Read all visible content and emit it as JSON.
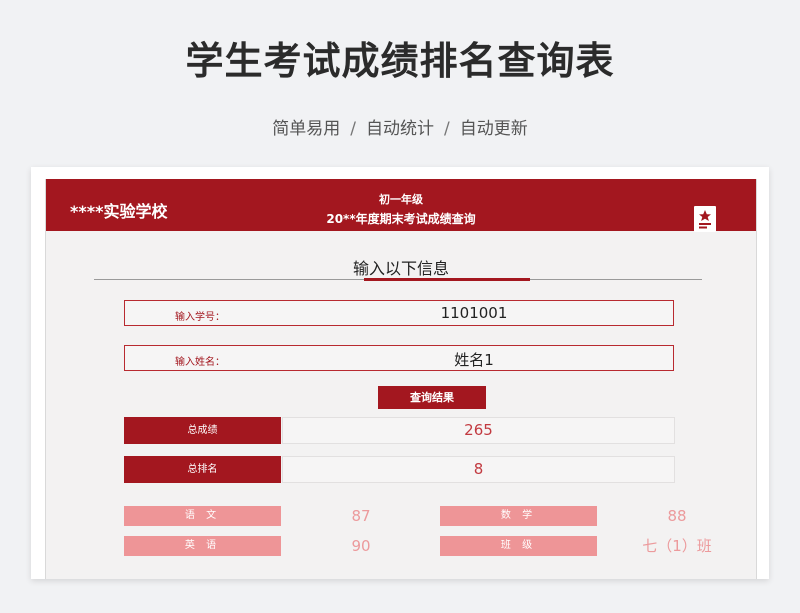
{
  "header": {
    "title": "学生考试成绩排名查询表",
    "subtitle_items": [
      "简单易用",
      "自动统计",
      "自动更新"
    ],
    "separator": "/"
  },
  "sheet": {
    "school": "****实验学校",
    "grade": "初一年级",
    "term": "20**年度期末考试成绩查询",
    "section_title": "输入以下信息",
    "inputs": {
      "student_id_label": "输入学号：",
      "student_id_value": "1101001",
      "name_label": "输入姓名：",
      "name_value": "姓名1"
    },
    "query_button": "查询结果",
    "results": {
      "total_label": "总成绩",
      "total_value": "265",
      "rank_label": "总排名",
      "rank_value": "8"
    },
    "details": {
      "chinese_label": "语 文",
      "chinese_value": "87",
      "math_label": "数 学",
      "math_value": "88",
      "english_label": "英 语",
      "english_value": "90",
      "class_label": "班 级",
      "class_value": "七（1）班"
    }
  },
  "colors": {
    "accent": "#a3171f",
    "light_accent": "#ee9597",
    "value_red": "#c23a40"
  }
}
